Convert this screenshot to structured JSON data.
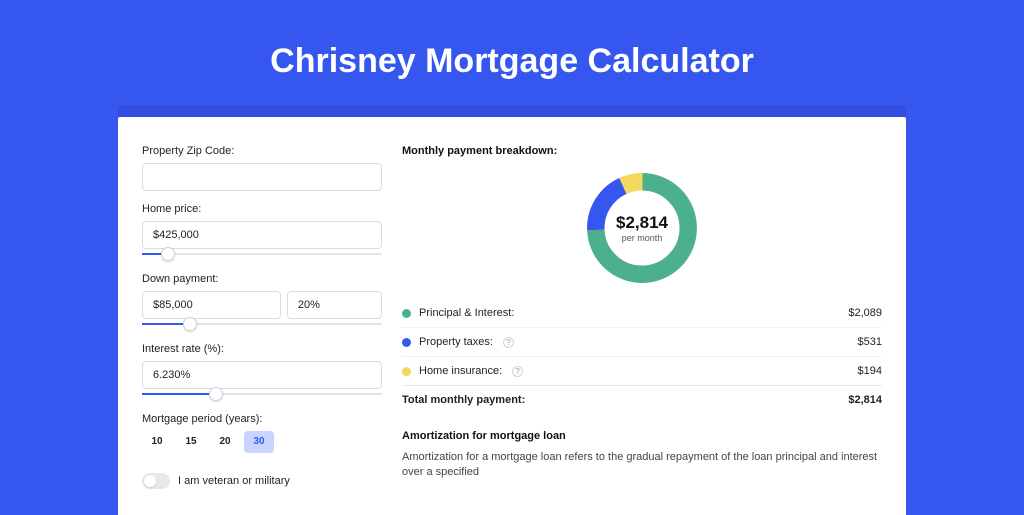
{
  "title": "Chrisney Mortgage Calculator",
  "form": {
    "zip_label": "Property Zip Code:",
    "zip_value": "",
    "home_price_label": "Home price:",
    "home_price_value": "$425,000",
    "home_price_slider_pct": 11,
    "down_label": "Down payment:",
    "down_value": "$85,000",
    "down_pct": "20%",
    "down_slider_pct": 20,
    "rate_label": "Interest rate (%):",
    "rate_value": "6.230%",
    "rate_slider_pct": 31,
    "period_label": "Mortgage period (years):",
    "periods": [
      "10",
      "15",
      "20",
      "30"
    ],
    "period_selected": "30",
    "veteran_label": "I am veteran or military"
  },
  "breakdown": {
    "title": "Monthly payment breakdown:",
    "amount": "$2,814",
    "per": "per month",
    "rows": [
      {
        "label": "Principal & Interest:",
        "value": "$2,089",
        "color": "#4db08c",
        "info": false
      },
      {
        "label": "Property taxes:",
        "value": "$531",
        "color": "#3557f0",
        "info": true
      },
      {
        "label": "Home insurance:",
        "value": "$194",
        "color": "#f5d75c",
        "info": true
      }
    ],
    "total_label": "Total monthly payment:",
    "total_value": "$2,814"
  },
  "chart_data": {
    "type": "pie",
    "title": "Monthly payment breakdown",
    "series": [
      {
        "name": "Principal & Interest",
        "value": 2089,
        "color": "#4db08c"
      },
      {
        "name": "Property taxes",
        "value": 531,
        "color": "#3557f0"
      },
      {
        "name": "Home insurance",
        "value": 194,
        "color": "#f5d75c"
      }
    ],
    "total": 2814
  },
  "amort": {
    "title": "Amortization for mortgage loan",
    "text": "Amortization for a mortgage loan refers to the gradual repayment of the loan principal and interest over a specified"
  }
}
